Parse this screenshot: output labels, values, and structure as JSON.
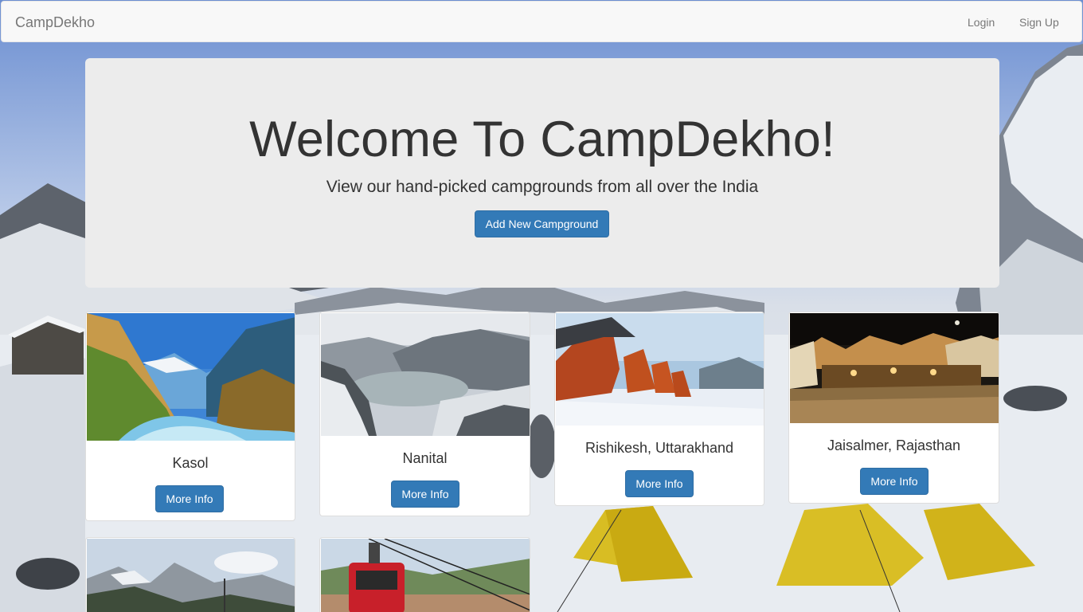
{
  "navbar": {
    "brand": "CampDekho",
    "login_label": "Login",
    "signup_label": "Sign Up"
  },
  "jumbotron": {
    "title": "Welcome To CampDekho!",
    "subtitle": "View our hand-picked campgrounds from all over the India",
    "add_button_label": "Add New Campground"
  },
  "campgrounds": [
    {
      "name": "Kasol",
      "button_label": "More Info"
    },
    {
      "name": "Nanital",
      "button_label": "More Info"
    },
    {
      "name": "Rishikesh, Uttarakhand",
      "button_label": "More Info"
    },
    {
      "name": "Jaisalmer, Rajasthan",
      "button_label": "More Info"
    }
  ],
  "colors": {
    "primary_button": "#337ab7",
    "navbar_bg": "#f8f8f8",
    "jumbotron_bg": "#ececec"
  }
}
